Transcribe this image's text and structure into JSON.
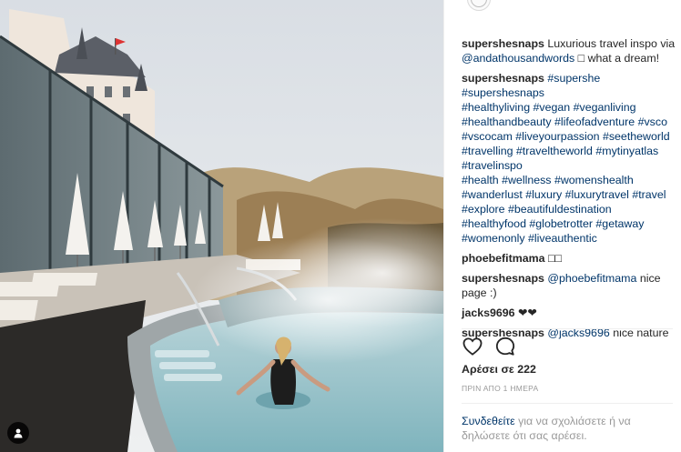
{
  "post": {
    "image": {
      "description_icon": "person-tag-icon"
    },
    "comments": [
      {
        "user": "supershesnaps",
        "text": "Luxurious travel inspo via",
        "mention": "@andathousandwords",
        "after": "□ what a dream!"
      },
      {
        "user": "supershesnaps",
        "lines": [
          "#supershe #supershesnaps",
          "#healthyliving #vegan #veganliving",
          "#healthandbeauty #lifeofadventure #vsco",
          "#vscocam #liveyourpassion #seetheworld",
          "#travelling #traveltheworld #mytinyatlas",
          "#travelinspo",
          "#health #wellness #womenshealth",
          "#wanderlust #luxury #luxurytravel #travel",
          "#explore #beautifuldestination",
          "#healthyfood #globetrotter #getaway",
          "#womenonly #liveauthentic"
        ]
      },
      {
        "user": "phoebefitmama",
        "text": "□□"
      },
      {
        "user": "supershesnaps",
        "mention": "@phoebefitmama",
        "text": "nice page :)"
      },
      {
        "user": "jacks9696",
        "text": "❤❤"
      },
      {
        "user": "supershesnaps",
        "mention": "@jacks9696",
        "text": "nice nature"
      }
    ],
    "actions": {
      "like_icon": "heart-icon",
      "comment_icon": "speech-bubble-icon"
    },
    "likes_label": "Αρέσει σε 222",
    "timestamp": "ΠΡΙΝ ΑΠΟ 1 ΗΜΕΡΑ",
    "login_prompt": {
      "link": "Συνδεθείτε",
      "text": "για να σχολιάσετε ή να δηλώσετε ότι σας αρέσει."
    }
  }
}
